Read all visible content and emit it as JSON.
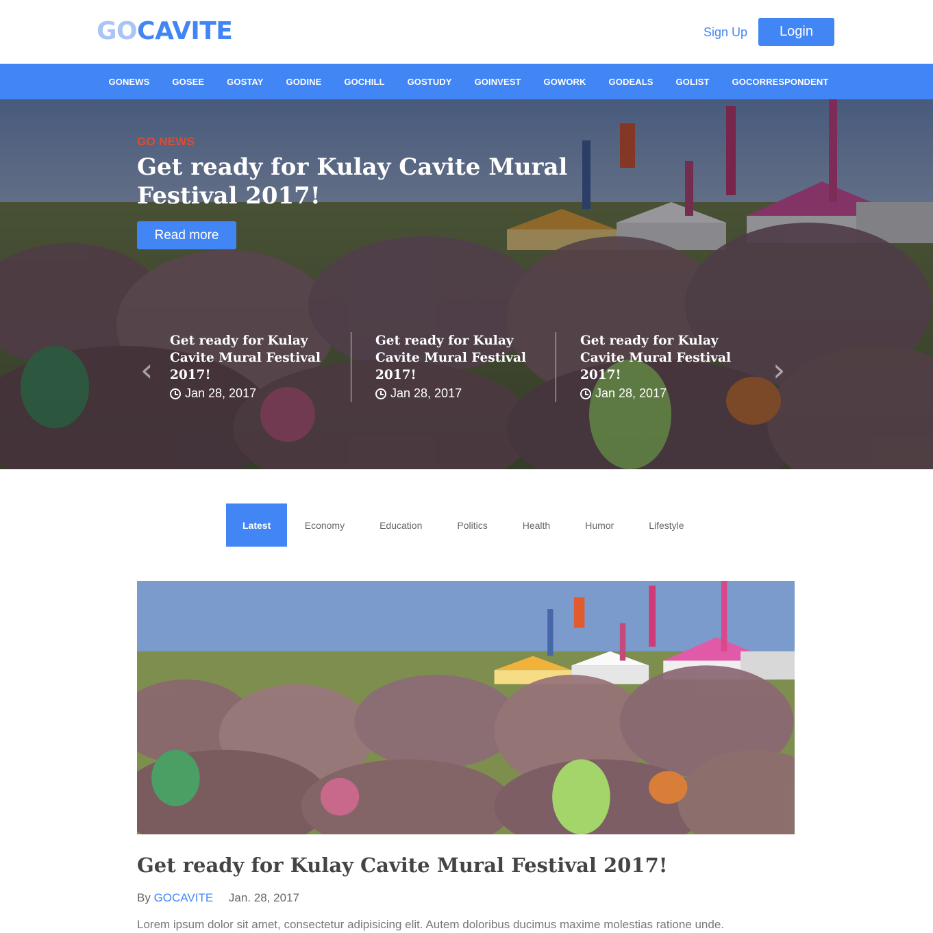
{
  "header": {
    "logo_go": "GO",
    "logo_cavite": "CAVITE",
    "signup_label": "Sign Up",
    "login_label": "Login"
  },
  "nav": {
    "items": [
      "GONEWS",
      "GOSEE",
      "GOSTAY",
      "GODINE",
      "GOCHILL",
      "GOSTUDY",
      "GOINVEST",
      "GOWORK",
      "GODEALS",
      "GOLIST",
      "GOCORRESPONDENT"
    ]
  },
  "hero": {
    "category": "GO NEWS",
    "title": "Get ready for Kulay Cavite Mural Festival 2017!",
    "read_more_label": "Read more",
    "slides": [
      {
        "title": "Get ready for Kulay Cavite Mural Festival 2017!",
        "date": "Jan 28, 2017"
      },
      {
        "title": "Get ready for Kulay Cavite Mural Festival 2017!",
        "date": "Jan 28, 2017"
      },
      {
        "title": "Get ready for Kulay Cavite Mural Festival 2017!",
        "date": "Jan 28, 2017"
      }
    ]
  },
  "tabs": [
    "Latest",
    "Economy",
    "Education",
    "Politics",
    "Health",
    "Humor",
    "Lifestyle"
  ],
  "article": {
    "title": "Get ready for Kulay Cavite Mural Festival 2017!",
    "by": "By",
    "author": "GOCAVITE",
    "date": "Jan. 28, 2017",
    "excerpt": "Lorem ipsum dolor sit amet, consectetur adipisicing elit. Autem doloribus ducimus maxime molestias ratione unde."
  },
  "colors": {
    "accent": "#4285f4",
    "category": "#e04b2e"
  }
}
